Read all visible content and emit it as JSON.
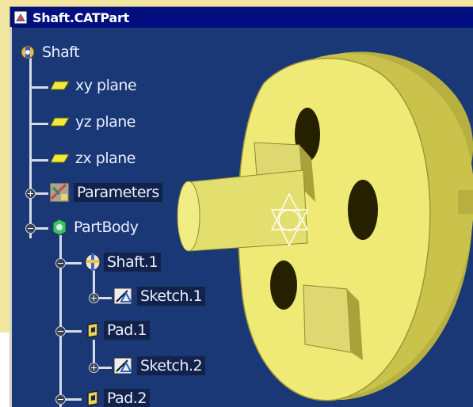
{
  "window": {
    "title": "Shaft.CATPart"
  },
  "tree": {
    "root": "Shaft",
    "items": [
      {
        "label": "xy plane"
      },
      {
        "label": "yz plane"
      },
      {
        "label": "zx plane"
      },
      {
        "label": "Parameters"
      },
      {
        "label": "PartBody"
      },
      {
        "label": "Shaft.1"
      },
      {
        "label": "Sketch.1"
      },
      {
        "label": "Pad.1"
      },
      {
        "label": "Sketch.2"
      },
      {
        "label": "Pad.2"
      }
    ]
  },
  "colors": {
    "viewport_background": "#1b3876",
    "title_bar": "#000e80",
    "part_yellow": "#e9e56b",
    "part_shadow": "#a9a33a"
  },
  "icons": [
    "catpart-icon",
    "part-icon",
    "plane-icon",
    "parameters-icon",
    "partbody-icon",
    "shaft-feature-icon",
    "sketch-icon",
    "pad-icon",
    "axis-compass-icon"
  ]
}
